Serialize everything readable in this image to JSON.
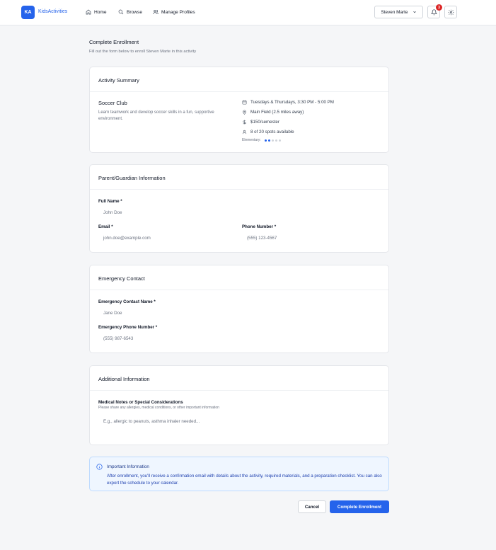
{
  "header": {
    "logo_text": "KA",
    "brand": "KidsActivities",
    "nav": [
      {
        "label": "Home",
        "icon": "home-icon"
      },
      {
        "label": "Browse",
        "icon": "search-icon"
      },
      {
        "label": "Manage Profiles",
        "icon": "users-icon"
      }
    ],
    "user": "Steven Marte",
    "notification_count": "3"
  },
  "page": {
    "title": "Complete Enrollment",
    "subtitle": "Fill out the form below to enroll Steven Marte in this activity"
  },
  "activity_summary": {
    "title": "Activity Summary",
    "name": "Soccer Club",
    "description": "Learn teamwork and develop soccer skills in a fun, supportive environment.",
    "schedule": "Tuesdays & Thursdays, 3:30 PM - 5:00 PM",
    "location": "Main Field (2.5 miles away)",
    "price": "$150/semester",
    "spots": "8 of 20 spots available",
    "level_label": "Elementary:",
    "level_filled": 2,
    "level_total": 5
  },
  "guardian": {
    "title": "Parent/Guardian Information",
    "full_name_label": "Full Name *",
    "full_name_placeholder": "John Doe",
    "email_label": "Email *",
    "email_placeholder": "john.doe@example.com",
    "phone_label": "Phone Number *",
    "phone_placeholder": "(555) 123-4567"
  },
  "emergency": {
    "title": "Emergency Contact",
    "name_label": "Emergency Contact Name *",
    "name_placeholder": "Jane Doe",
    "phone_label": "Emergency Phone Number *",
    "phone_placeholder": "(555) 987-6543"
  },
  "additional": {
    "title": "Additional Information",
    "notes_label": "Medical Notes or Special Considerations",
    "notes_helper": "Please share any allergies, medical conditions, or other important information",
    "notes_placeholder": "E.g., allergic to peanuts, asthma inhaler needed..."
  },
  "info": {
    "title": "Important Information",
    "text": "After enrollment, you'll receive a confirmation email with details about the activity, required materials, and a preparation checklist. You can also export the schedule to your calendar."
  },
  "actions": {
    "cancel": "Cancel",
    "submit": "Complete Enrollment"
  },
  "colors": {
    "primary": "#2563eb",
    "badge": "#dc2626",
    "info_bg": "#eff6ff"
  }
}
